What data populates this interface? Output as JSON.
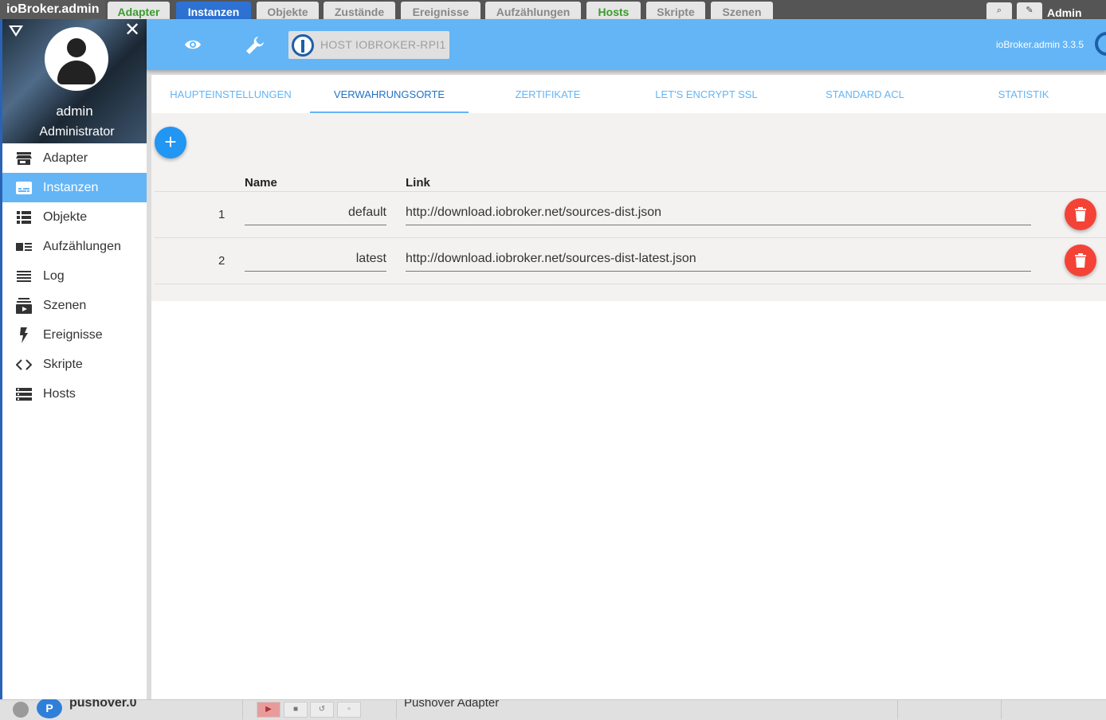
{
  "old_topbar": {
    "brand": "ioBroker.admin",
    "tabs": [
      {
        "label": "Adapter"
      },
      {
        "label": "Instanzen"
      },
      {
        "label": "Objekte"
      },
      {
        "label": "Zustände"
      },
      {
        "label": "Ereignisse"
      },
      {
        "label": "Aufzählungen"
      },
      {
        "label": "Hosts"
      },
      {
        "label": "Skripte"
      },
      {
        "label": "Szenen"
      }
    ],
    "user_label": "Admin"
  },
  "drawer": {
    "username": "admin",
    "role": "Administrator",
    "items": [
      {
        "label": "Adapter",
        "icon": "store-icon"
      },
      {
        "label": "Instanzen",
        "icon": "subtitles-icon",
        "active": true
      },
      {
        "label": "Objekte",
        "icon": "list-icon"
      },
      {
        "label": "Aufzählungen",
        "icon": "enum-icon"
      },
      {
        "label": "Log",
        "icon": "log-lines-icon"
      },
      {
        "label": "Szenen",
        "icon": "subscriptions-icon"
      },
      {
        "label": "Ereignisse",
        "icon": "flash-icon"
      },
      {
        "label": "Skripte",
        "icon": "code-icon"
      },
      {
        "label": "Hosts",
        "icon": "storage-icon"
      }
    ]
  },
  "appbar": {
    "host_button": "HOST IOBROKER-RPI1",
    "version": "ioBroker.admin 3.3.5"
  },
  "tabs": [
    {
      "label": "Haupteinstellungen"
    },
    {
      "label": "Verwahrungsorte",
      "active": true
    },
    {
      "label": "Zertifikate"
    },
    {
      "label": "Let's encrypt SSL"
    },
    {
      "label": "Standard ACL"
    },
    {
      "label": "Statistik"
    }
  ],
  "table": {
    "headers": {
      "name": "Name",
      "link": "Link"
    },
    "rows": [
      {
        "index": "1",
        "name": "default",
        "link": "http://download.iobroker.net/sources-dist.json"
      },
      {
        "index": "2",
        "name": "latest",
        "link": "http://download.iobroker.net/sources-dist-latest.json"
      }
    ]
  },
  "bottom_strip": {
    "name": "pushover.0",
    "description": "Pushover Adapter"
  },
  "colors": {
    "appbar": "#64b5f6",
    "accent": "#2196f3",
    "delete": "#f44336"
  }
}
